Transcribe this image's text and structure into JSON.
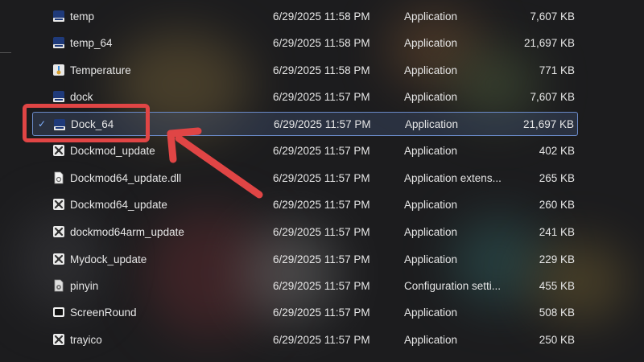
{
  "files": [
    {
      "name": "temp",
      "date": "6/29/2025 11:58 PM",
      "type": "Application",
      "size": "7,607 KB",
      "icon": "app-icon",
      "selected": false
    },
    {
      "name": "temp_64",
      "date": "6/29/2025 11:58 PM",
      "type": "Application",
      "size": "21,697 KB",
      "icon": "app-icon",
      "selected": false
    },
    {
      "name": "Temperature",
      "date": "6/29/2025 11:58 PM",
      "type": "Application",
      "size": "771 KB",
      "icon": "thermometer-app-icon",
      "selected": false
    },
    {
      "name": "dock",
      "date": "6/29/2025 11:57 PM",
      "type": "Application",
      "size": "7,607 KB",
      "icon": "app-icon",
      "selected": false
    },
    {
      "name": "Dock_64",
      "date": "6/29/2025 11:57 PM",
      "type": "Application",
      "size": "21,697 KB",
      "icon": "app-icon",
      "selected": true
    },
    {
      "name": "Dockmod_update",
      "date": "6/29/2025 11:57 PM",
      "type": "Application",
      "size": "402 KB",
      "icon": "tool-app-icon",
      "selected": false
    },
    {
      "name": "Dockmod64_update.dll",
      "date": "6/29/2025 11:57 PM",
      "type": "Application extens...",
      "size": "265 KB",
      "icon": "dll-file-icon",
      "selected": false
    },
    {
      "name": "Dockmod64_update",
      "date": "6/29/2025 11:57 PM",
      "type": "Application",
      "size": "260 KB",
      "icon": "tool-app-icon",
      "selected": false
    },
    {
      "name": "dockmod64arm_update",
      "date": "6/29/2025 11:57 PM",
      "type": "Application",
      "size": "241 KB",
      "icon": "tool-app-icon",
      "selected": false
    },
    {
      "name": "Mydock_update",
      "date": "6/29/2025 11:57 PM",
      "type": "Application",
      "size": "229 KB",
      "icon": "tool-app-icon",
      "selected": false
    },
    {
      "name": "pinyin",
      "date": "6/29/2025 11:57 PM",
      "type": "Configuration setti...",
      "size": "455 KB",
      "icon": "config-file-icon",
      "selected": false
    },
    {
      "name": "ScreenRound",
      "date": "6/29/2025 11:57 PM",
      "type": "Application",
      "size": "508 KB",
      "icon": "window-app-icon",
      "selected": false
    },
    {
      "name": "trayico",
      "date": "6/29/2025 11:57 PM",
      "type": "Application",
      "size": "250 KB",
      "icon": "tool-app-icon",
      "selected": false
    }
  ],
  "annotation": {
    "color": "#e04545"
  }
}
